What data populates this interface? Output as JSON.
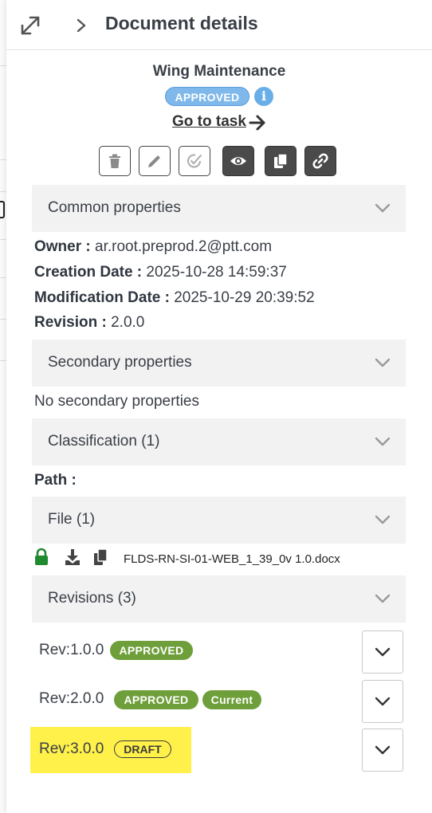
{
  "header": {
    "title": "Document details",
    "icons": [
      "expand-icon",
      "chevron-right-icon"
    ]
  },
  "document": {
    "name": "Wing Maintenance",
    "status": "APPROVED",
    "go_to_task": "Go to task"
  },
  "toolbar": [
    "delete-icon",
    "edit-icon",
    "approve-icon",
    "view-icon",
    "copy-icon",
    "link-icon"
  ],
  "sections": {
    "common": "Common properties",
    "secondary": "Secondary properties",
    "classification": "Classification (1)",
    "file": "File (1)",
    "revisions": "Revisions (3)"
  },
  "common_properties": {
    "owner_label": "Owner :",
    "owner": "ar.root.preprod.2@ptt.com",
    "creation_label": "Creation Date :",
    "creation": "2025-10-28 14:59:37",
    "modification_label": "Modification Date :",
    "modification": "2025-10-29 20:39:52",
    "revision_label": "Revision :",
    "revision": "2.0.0"
  },
  "secondary_properties": {
    "empty_text": "No secondary properties"
  },
  "classification": {
    "path_label": "Path :"
  },
  "file": {
    "name": "FLDS-RN-SI-01-WEB_1_39_0v 1.0.docx"
  },
  "revisions": [
    {
      "label": "Rev:1.0.0",
      "badges": [
        "APPROVED"
      ]
    },
    {
      "label": "Rev:2.0.0",
      "badges": [
        "APPROVED",
        "Current"
      ]
    },
    {
      "label": "Rev:3.0.0",
      "badges": [
        "DRAFT"
      ]
    }
  ],
  "colors": {
    "approved_blue": "#7fb8ea",
    "approved_green": "#6e9f3a",
    "highlight": "#fff04a",
    "dark_button": "#4a4a4a"
  }
}
